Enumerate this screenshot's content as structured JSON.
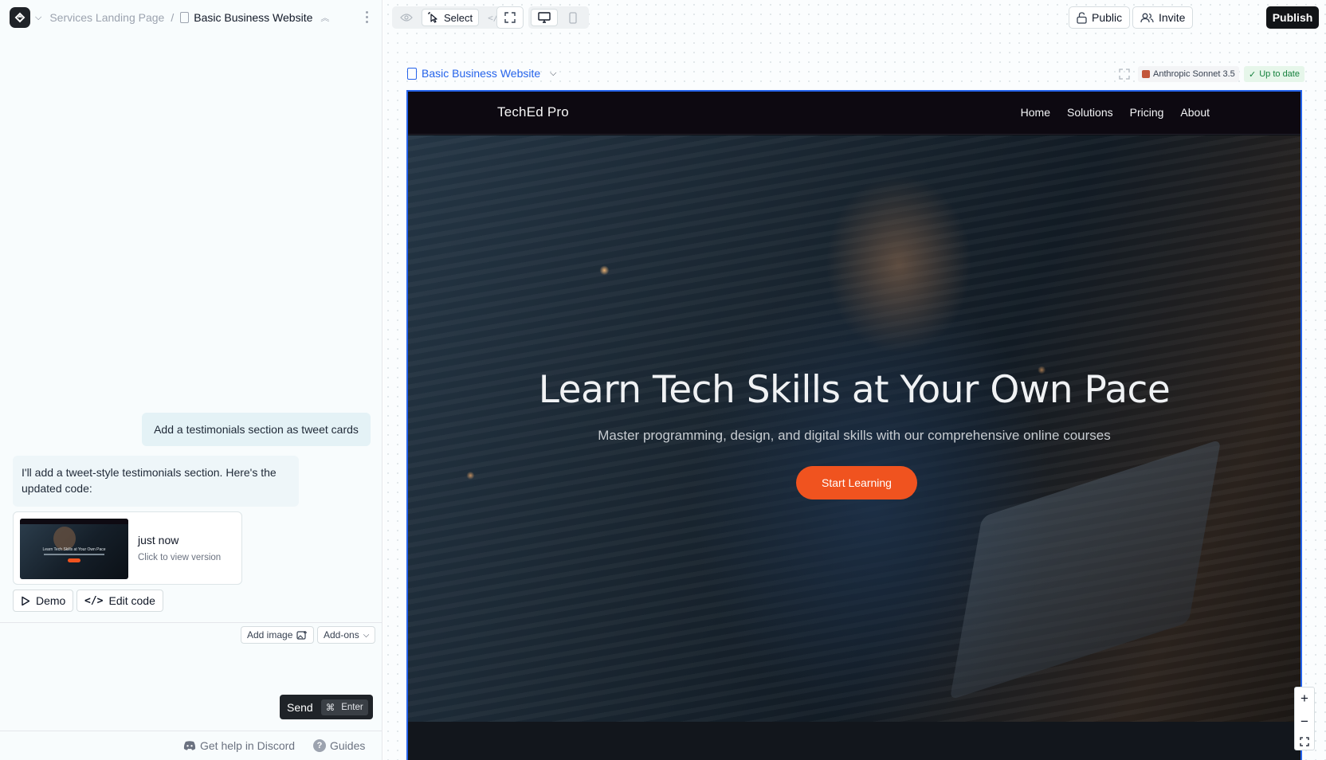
{
  "app": {
    "breadcrumb": {
      "project": "Services Landing Page",
      "separator": "/",
      "page": "Basic Business Website"
    }
  },
  "chat": {
    "user_message": "Add a testimonials section as tweet cards",
    "assistant_message": "I'll add a tweet-style testimonials section. Here's the updated code:",
    "version_card": {
      "time": "just now",
      "hint": "Click to view version",
      "thumbnail_title": "Learn Tech Skills at Your Own Pace"
    },
    "actions": {
      "demo": "Demo",
      "edit_code": "Edit code"
    },
    "composer": {
      "add_image": "Add image",
      "addons": "Add-ons",
      "send": "Send",
      "shortcut_symbol": "⌘",
      "shortcut_key": "Enter"
    },
    "footer": {
      "discord": "Get help in Discord",
      "guides": "Guides"
    }
  },
  "toolbar": {
    "select": "Select",
    "public": "Public",
    "invite": "Invite",
    "publish": "Publish"
  },
  "preview_header": {
    "page_name": "Basic Business Website",
    "model": "Anthropic Sonnet 3.5",
    "status": "Up to date"
  },
  "site": {
    "brand": "TechEd Pro",
    "nav": [
      "Home",
      "Solutions",
      "Pricing",
      "About"
    ],
    "hero_title": "Learn Tech Skills at Your Own Pace",
    "hero_subtitle": "Master programming, design, and digital skills with our comprehensive online courses",
    "cta": "Start Learning",
    "accent_color": "#f0531f"
  },
  "zoom": {
    "in": "+",
    "out": "−"
  }
}
